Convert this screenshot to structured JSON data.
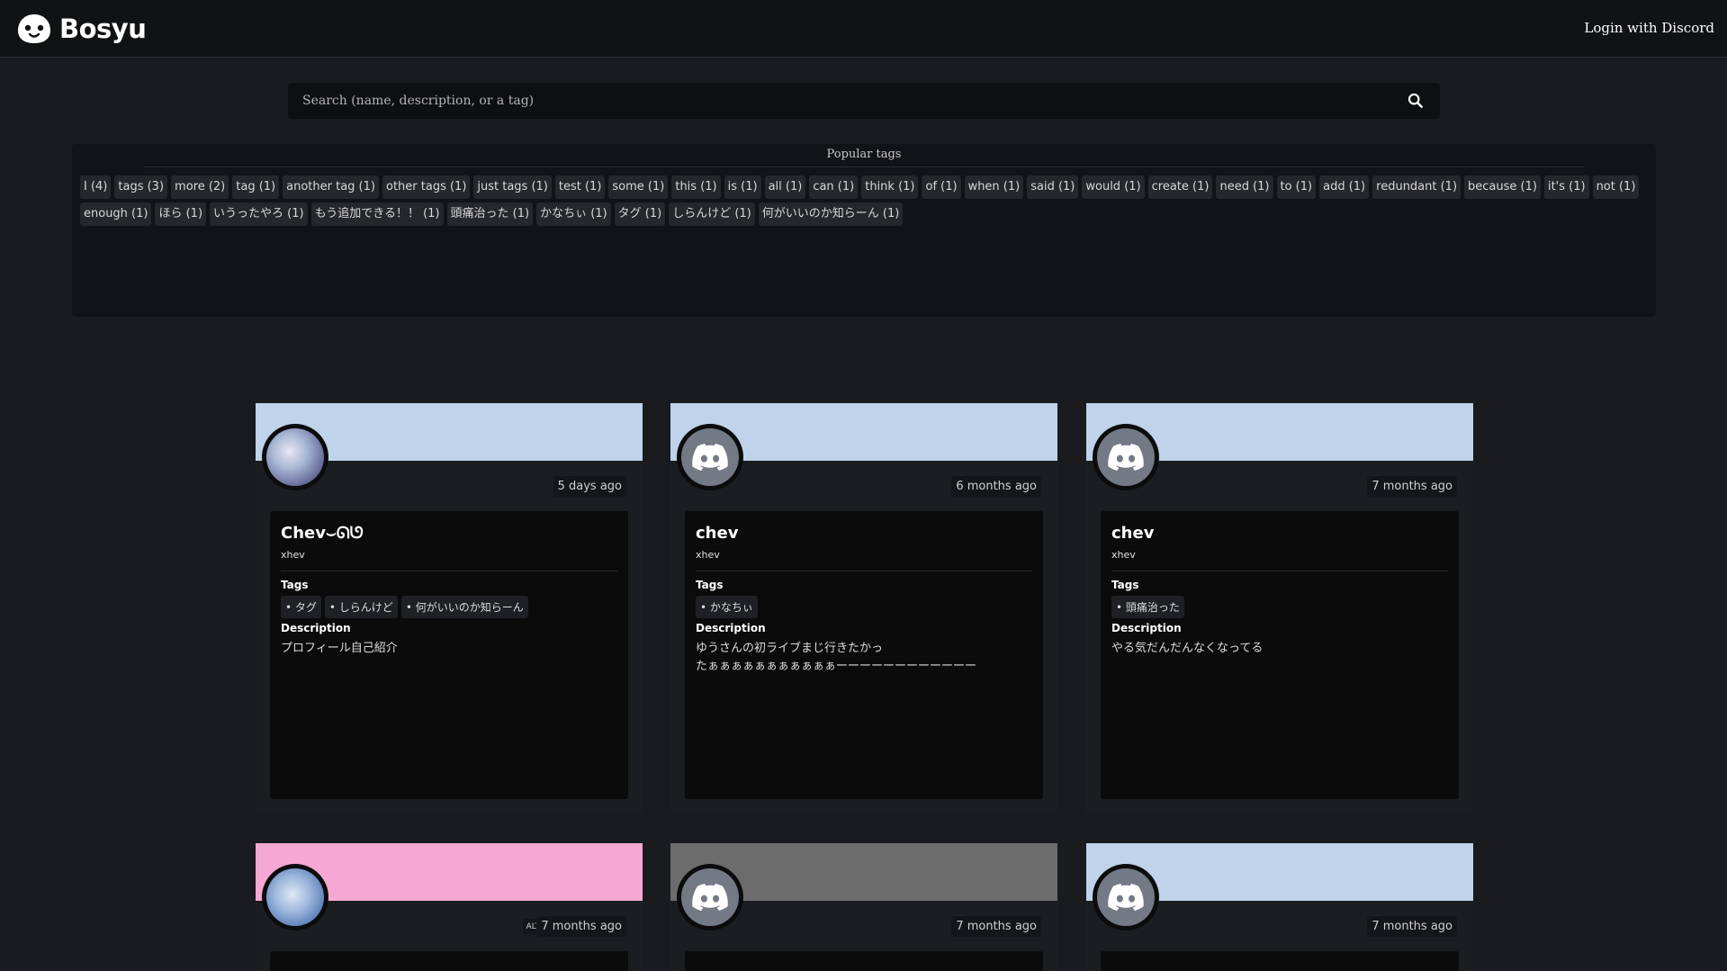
{
  "header": {
    "brand": "Bosyu",
    "login_label": "Login with Discord"
  },
  "search": {
    "placeholder": "Search (name, description, or a tag)"
  },
  "popular_tags": {
    "title": "Popular tags",
    "items": [
      "I (4)",
      "tags (3)",
      "more (2)",
      "tag (1)",
      "another tag (1)",
      "other tags (1)",
      "just tags (1)",
      "test (1)",
      "some (1)",
      "this (1)",
      "is (1)",
      "all (1)",
      "can (1)",
      "think (1)",
      "of (1)",
      "when (1)",
      "said (1)",
      "would (1)",
      "create (1)",
      "need (1)",
      "to (1)",
      "add (1)",
      "redundant (1)",
      "because (1)",
      "it's (1)",
      "not (1)",
      "enough (1)",
      "ほら (1)",
      "いうったやろ (1)",
      "もう追加できる！！ (1)",
      "頭痛治った (1)",
      "かなちぃ (1)",
      "タグ (1)",
      "しらんけど (1)",
      "何がいいのか知らーん (1)"
    ]
  },
  "labels": {
    "tags": "Tags",
    "description": "Description",
    "alt": "ALT"
  },
  "cards": [
    {
      "banner_color": "#bfd3ea",
      "avatar": "image",
      "time": "5 days ago",
      "name": "Chev⌣ᘏᘎ",
      "user": "xhev",
      "tags": [
        "• タグ",
        "• しらんけど",
        "• 何がいいのか知らーん"
      ],
      "description": "プロフィール自己紹介"
    },
    {
      "banner_color": "#bfd3ea",
      "avatar": "discord-icon",
      "time": "6 months ago",
      "name": "chev",
      "user": "xhev",
      "tags": [
        "• かなちぃ"
      ],
      "description": "ゆうさんの初ライブまじ行きたかっ\nたぁぁぁぁぁぁぁぁぁぁぁーーーーーーーーーーーー"
    },
    {
      "banner_color": "#bfd3ea",
      "avatar": "discord-icon",
      "time": "7 months ago",
      "name": "chev",
      "user": "xhev",
      "tags": [
        "• 頭痛治った"
      ],
      "description": "やる気だんだんなくなってる"
    },
    {
      "banner_color": "#f5a8d3",
      "avatar": "image",
      "time": "7 months ago",
      "alt": true
    },
    {
      "banner_color": "#6c6c6c",
      "avatar": "discord-icon",
      "time": "7 months ago"
    },
    {
      "banner_color": "#bfd3ea",
      "avatar": "discord-icon",
      "time": "7 months ago"
    }
  ]
}
